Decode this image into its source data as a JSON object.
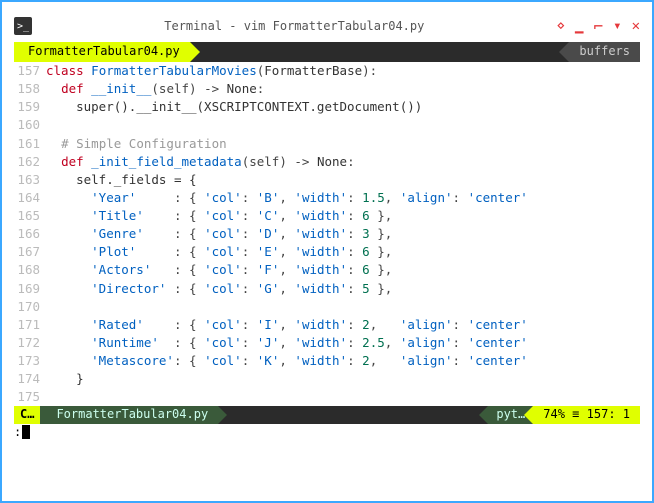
{
  "window": {
    "title": "Terminal - vim FormatterTabular04.py"
  },
  "tabs": {
    "active": "FormatterTabular04.py",
    "right": "buffers"
  },
  "code": {
    "lines": [
      {
        "n": "157",
        "t": "class",
        "kw": true,
        "cls": "FormatterTabularMovies",
        "base": "FormatterBase"
      },
      {
        "n": "158",
        "t": "def",
        "indent": "  ",
        "fn": "__init__",
        "sig": "(self) -> None:"
      },
      {
        "n": "159",
        "indent": "    ",
        "body": "super().__init__(XSCRIPTCONTEXT.getDocument())"
      },
      {
        "n": "160",
        "blank": true
      },
      {
        "n": "161",
        "indent": "  ",
        "cmt": "# Simple Configuration"
      },
      {
        "n": "162",
        "t": "def",
        "indent": "  ",
        "fn": "_init_field_metadata",
        "sig": "(self) -> None:"
      },
      {
        "n": "163",
        "indent": "    ",
        "body": "self._fields = {"
      },
      {
        "n": "164",
        "indent": "      ",
        "key": "'Year'",
        "pad": "     ",
        "val": ": { 'col': 'B', 'width': 1.5, 'align': 'center'"
      },
      {
        "n": "165",
        "indent": "      ",
        "key": "'Title'",
        "pad": "    ",
        "val": ": { 'col': 'C', 'width': 6 },"
      },
      {
        "n": "166",
        "indent": "      ",
        "key": "'Genre'",
        "pad": "    ",
        "val": ": { 'col': 'D', 'width': 3 },"
      },
      {
        "n": "167",
        "indent": "      ",
        "key": "'Plot'",
        "pad": "     ",
        "val": ": { 'col': 'E', 'width': 6 },"
      },
      {
        "n": "168",
        "indent": "      ",
        "key": "'Actors'",
        "pad": "   ",
        "val": ": { 'col': 'F', 'width': 6 },"
      },
      {
        "n": "169",
        "indent": "      ",
        "key": "'Director'",
        "pad": " ",
        "val": ": { 'col': 'G', 'width': 5 },"
      },
      {
        "n": "170",
        "blank": true
      },
      {
        "n": "171",
        "indent": "      ",
        "key": "'Rated'",
        "pad": "    ",
        "val": ": { 'col': 'I', 'width': 2,   'align': 'center'"
      },
      {
        "n": "172",
        "indent": "      ",
        "key": "'Runtime'",
        "pad": "  ",
        "val": ": { 'col': 'J', 'width': 2.5, 'align': 'center'"
      },
      {
        "n": "173",
        "indent": "      ",
        "key": "'Metascore'",
        "pad": "",
        "val": ": { 'col': 'K', 'width': 2,   'align': 'center'"
      },
      {
        "n": "174",
        "indent": "    ",
        "body": "}"
      },
      {
        "n": "175",
        "blank": true
      }
    ]
  },
  "status": {
    "mode": "C…",
    "file": "FormatterTabular04.py",
    "filetype": "pyt…",
    "percent": "74%",
    "line": "157",
    "col": "1"
  },
  "cmd": {
    "prompt": ":"
  }
}
